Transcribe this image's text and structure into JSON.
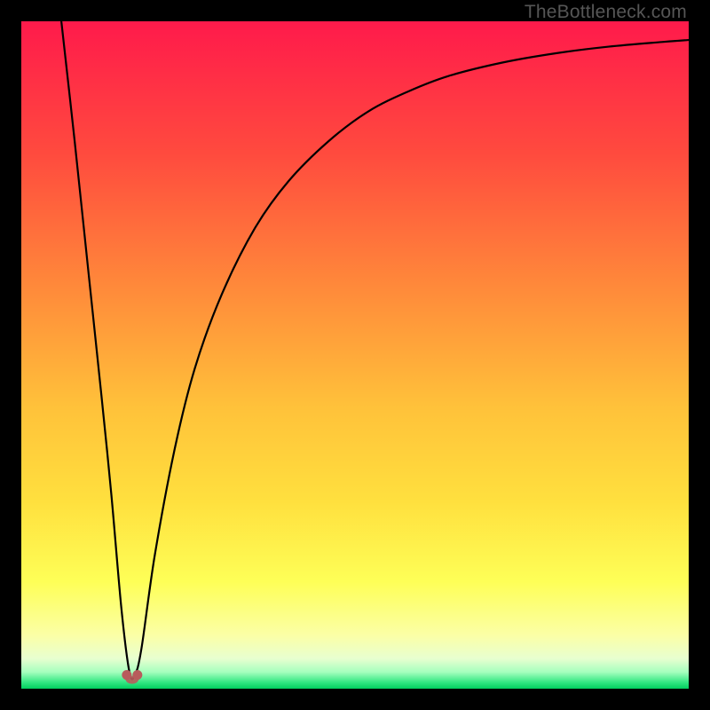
{
  "watermark": "TheBottleneck.com",
  "colors": {
    "black": "#000000",
    "gradient_top": "#ff1744",
    "gradient_mid_upper": "#ff6e40",
    "gradient_mid": "#ffc107",
    "gradient_mid_lower": "#ffee58",
    "gradient_lower": "#fff59d",
    "gradient_green": "#00e676",
    "curve": "#000000",
    "marker": "#b85c5c"
  },
  "chart_data": {
    "type": "line",
    "title": "",
    "xlabel": "",
    "ylabel": "",
    "xlim": [
      0,
      100
    ],
    "ylim": [
      0,
      100
    ],
    "series": [
      {
        "name": "bottleneck-curve",
        "x": [
          6,
          8,
          10,
          12,
          13.5,
          15,
          16.2,
          17,
          18,
          20,
          23,
          26,
          30,
          35,
          40,
          46,
          52,
          58,
          64,
          72,
          80,
          88,
          96,
          100
        ],
        "y": [
          100,
          82,
          63,
          44,
          29,
          12,
          2.5,
          2,
          6,
          20,
          36,
          48,
          59,
          69,
          76,
          82,
          86.5,
          89.5,
          91.8,
          93.8,
          95.2,
          96.2,
          96.9,
          97.2
        ]
      }
    ],
    "annotations": [
      {
        "type": "marker",
        "shape": "u-blob",
        "x": 16.6,
        "y": 1.8,
        "color": "#b85c5c"
      }
    ],
    "background_gradient": {
      "stops": [
        {
          "offset": 0.0,
          "color": "#ff1a4b"
        },
        {
          "offset": 0.2,
          "color": "#ff4b3e"
        },
        {
          "offset": 0.4,
          "color": "#ff8a3a"
        },
        {
          "offset": 0.58,
          "color": "#ffc23a"
        },
        {
          "offset": 0.72,
          "color": "#ffe03e"
        },
        {
          "offset": 0.84,
          "color": "#feff57"
        },
        {
          "offset": 0.92,
          "color": "#fbffa6"
        },
        {
          "offset": 0.955,
          "color": "#e8ffd0"
        },
        {
          "offset": 0.975,
          "color": "#a6ffbe"
        },
        {
          "offset": 0.99,
          "color": "#35e884"
        },
        {
          "offset": 1.0,
          "color": "#00cf5f"
        }
      ]
    }
  }
}
